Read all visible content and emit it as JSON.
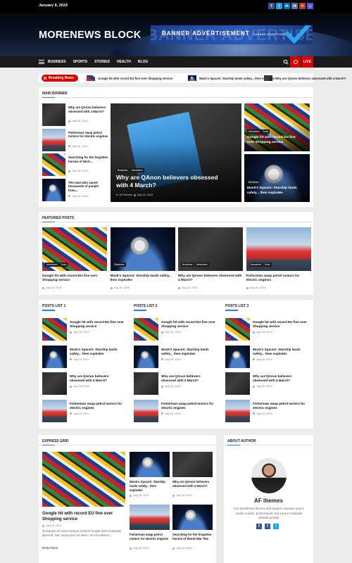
{
  "topbar": {
    "date": "January 8, 2024",
    "social": [
      {
        "icon": "facebook-icon",
        "glyph": "f",
        "color": "#3b5998"
      },
      {
        "icon": "twitter-icon",
        "glyph": "t",
        "color": "#1da1f2"
      },
      {
        "icon": "linkedin-icon",
        "glyph": "in",
        "color": "#0077b5"
      },
      {
        "icon": "vk-icon",
        "glyph": "vk",
        "color": "#4a76a8"
      },
      {
        "icon": "mail-icon",
        "glyph": "✉",
        "color": "#c0392b"
      },
      {
        "icon": "instagram-icon",
        "glyph": "◎",
        "color": "#5851db"
      }
    ]
  },
  "header": {
    "site_title": "MORENEWS BLOCK",
    "banner_big": "BANNER ADVERTISEMENT",
    "banner_main": "BANNER ADVERTISEMENT",
    "banner_small": "BANNER ADVERTISEMENT"
  },
  "nav": {
    "items": [
      "BUSINESS",
      "SPORTS",
      "STORIES",
      "HEALTH",
      "BLOG"
    ],
    "live": "LIVE"
  },
  "ticker": {
    "label": "Breaking News",
    "items": [
      "Google hit with record EU fine over Shopping service",
      "Musk's SpaceX: Starship lands safely... then explodes",
      "Why are QAnon believers obsessed with 4 March?"
    ]
  },
  "main_banner": {
    "heading": "MAIN BANNER",
    "list": [
      {
        "title": "Why are QAnon believers obsessed with 4 March?",
        "date": "July 18, 2019"
      },
      {
        "title": "Fisherman swap petrol motors for electric engines",
        "date": "July 18, 2019"
      },
      {
        "title": "Searching for the forgotten heroes of Worl...",
        "date": "July 18, 2019"
      },
      {
        "title": "The man who saved thousands of people from...",
        "date": "July 18, 2019"
      }
    ],
    "feature": {
      "cats": [
        "Business",
        "Newsfeed"
      ],
      "title": "Why are QAnon believers obsessed with 4 March?",
      "author": "AF themes",
      "date": "July 18, 2019"
    },
    "side": [
      {
        "cats": [
          "Newsfeed",
          "Tools"
        ],
        "title": "Google hit with record EU fine over Shopping service",
        "date": "July 18, 2019"
      },
      {
        "cats": [
          "Business"
        ],
        "title": "Musk's SpaceX: Starship lands safely... then explodes",
        "date": "July 18, 2019"
      }
    ]
  },
  "featured": {
    "heading": "FEATURED POSTS",
    "items": [
      {
        "cats": [
          "Newsfeed",
          "Tools"
        ],
        "title": "Google hit with record EU fine over Shopping service",
        "date": "July 18, 2019"
      },
      {
        "cats": [
          "Business"
        ],
        "title": "Musk's SpaceX: Starship lands safely... then explodes",
        "date": "July 18, 2019"
      },
      {
        "cats": [
          "Business",
          "Newsfeed"
        ],
        "title": "Why are QAnon believers obsessed with 4 March?",
        "date": "July 18, 2019"
      },
      {
        "cats": [
          "Newsfeed",
          "Tools"
        ],
        "title": "Fisherman swap petrol motors for electric engines",
        "date": "July 18, 2019"
      }
    ]
  },
  "posts_lists": [
    {
      "heading": "POSTS LIST 1",
      "items": [
        {
          "title": "Google hit with record EU fine over Shopping service",
          "date": "July 18, 2019"
        },
        {
          "title": "Musk's SpaceX: Starship lands safely... then explodes",
          "date": "July 18, 2019"
        },
        {
          "title": "Why are QAnon believers obsessed with 4 March?",
          "date": "July 18, 2019"
        },
        {
          "title": "Fisherman swap petrol motors for electric engines",
          "date": "July 18, 2019"
        }
      ]
    },
    {
      "heading": "POSTS LIST 2",
      "items": [
        {
          "title": "Google hit with record EU fine over Shopping service",
          "date": "July 18, 2019"
        },
        {
          "title": "Musk's SpaceX: Starship lands safely... then explodes",
          "date": "July 18, 2019"
        },
        {
          "title": "Why are QAnon believers obsessed with 4 March?",
          "date": "July 18, 2019"
        },
        {
          "title": "Fisherman swap petrol motors for electric engines",
          "date": "July 18, 2019"
        }
      ]
    },
    {
      "heading": "POSTS LIST 3",
      "items": [
        {
          "title": "Google hit with record EU fine over Shopping service",
          "date": "July 18, 2019"
        },
        {
          "title": "Musk's SpaceX: Starship lands safely... then explodes",
          "date": "July 18, 2019"
        },
        {
          "title": "Why are QAnon believers obsessed with 4 March?",
          "date": "July 18, 2019"
        },
        {
          "title": "Fisherman swap petrol motors for electric engines",
          "date": "July 18, 2019"
        }
      ]
    }
  ],
  "express": {
    "heading": "EXPRESS GRID",
    "main": {
      "title": "Google hit with record EU fine over Shopping service",
      "date": "July 18, 2019",
      "excerpt": "Quisquam sit amet cumque incidunt feugiat dicta molestiae placerat. Nec turpis proin sit amet, nis eos taliimaz...",
      "read_more": "Read More"
    },
    "grid": [
      {
        "title": "Musk's SpaceX: Starship lands safely... then explodes",
        "date": "July 18, 2019"
      },
      {
        "title": "Why are QAnon believers obsessed with 4 March?",
        "date": "July 18, 2019"
      },
      {
        "title": "Fisherman swap petrol motors for electric engines",
        "date": "July 18, 2019"
      },
      {
        "title": "Searching for the forgotten heroes of World War Two",
        "date": "July 18, 2019"
      }
    ]
  },
  "author": {
    "heading": "ABOUT AUTHOR",
    "name": "AF themes",
    "bio": "Our WordPress themes and plugins empower you to create a sleek, professional, and easy-to-maintain website quickly.",
    "social": [
      "facebook-icon",
      "facebook-icon",
      "twitter-icon"
    ]
  }
}
